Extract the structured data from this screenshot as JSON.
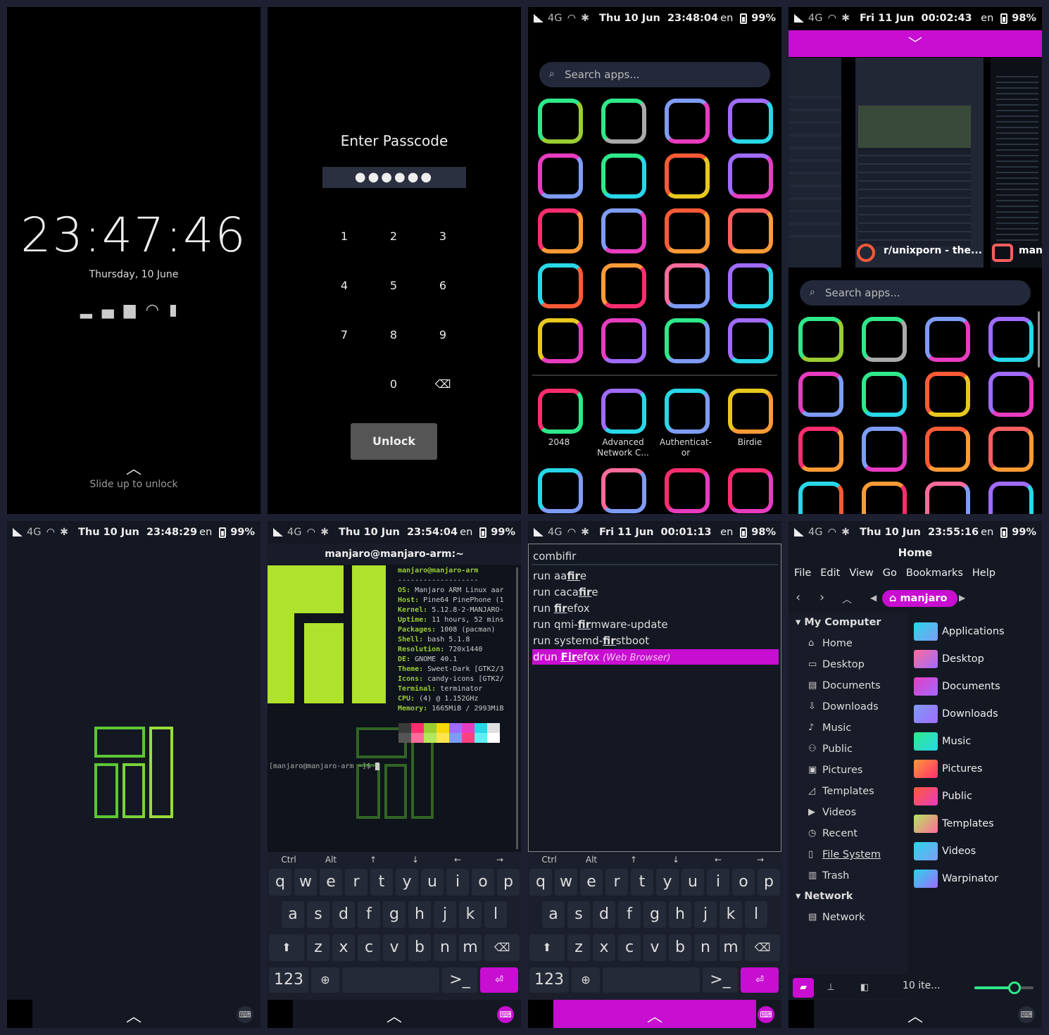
{
  "status": {
    "net": "4G",
    "lang": "en",
    "p3": {
      "date": "Thu 10 Jun",
      "time": "23:48:04",
      "battery": "99%"
    },
    "p4": {
      "date": "Fri 11 Jun",
      "time": "00:02:43",
      "battery": "98%"
    },
    "p5": {
      "date": "Thu 10 Jun",
      "time": "23:48:29",
      "battery": "99%"
    },
    "p6": {
      "date": "Thu 10 Jun",
      "time": "23:54:04",
      "battery": "99%"
    },
    "p7": {
      "date": "Fri 11 Jun",
      "time": "00:01:13",
      "battery": "98%"
    },
    "p8": {
      "date": "Thu 10 Jun",
      "time": "23:55:16",
      "battery": "99%"
    }
  },
  "lock": {
    "time": "23:47:46",
    "date": "Thursday, 10 June",
    "hint": "Slide up to unlock"
  },
  "passcode": {
    "title": "Enter Passcode",
    "dots": "●●●●●●",
    "keys": [
      "1",
      "2",
      "3",
      "4",
      "5",
      "6",
      "7",
      "8",
      "9",
      "0"
    ],
    "unlock": "Unlock"
  },
  "launcher": {
    "search_placeholder": "Search apps...",
    "apps": [
      {
        "label": "2048"
      },
      {
        "label": "Advanced Network C..."
      },
      {
        "label": "Authenticat-or"
      },
      {
        "label": "Birdie"
      }
    ]
  },
  "overview": {
    "win1_title": "r/unixporn - the...",
    "win2_title": "manj"
  },
  "terminal": {
    "title": "manjaro@manjaro-arm:~",
    "header": "manjaro@manjaro-arm",
    "rule": "-------------------",
    "info": [
      {
        "k": "OS:",
        "v": "Manjaro ARM Linux aar"
      },
      {
        "k": "Host:",
        "v": "Pine64 PinePhone (1"
      },
      {
        "k": "Kernel:",
        "v": "5.12.8-2-MANJARO-"
      },
      {
        "k": "Uptime:",
        "v": "11 hours, 52 mins"
      },
      {
        "k": "Packages:",
        "v": "1008 (pacman)"
      },
      {
        "k": "Shell:",
        "v": "bash 5.1.8"
      },
      {
        "k": "Resolution:",
        "v": "720x1440"
      },
      {
        "k": "DE:",
        "v": "GNOME 40.1"
      },
      {
        "k": "Theme:",
        "v": "Sweet-Dark [GTK2/3"
      },
      {
        "k": "Icons:",
        "v": "candy-icons [GTK2/"
      },
      {
        "k": "Terminal:",
        "v": "terminator"
      },
      {
        "k": "CPU:",
        "v": "(4) @ 1.152GHz"
      },
      {
        "k": "Memory:",
        "v": "1665MiB / 2993MiB"
      }
    ],
    "prompt": "[manjaro@manjaro-arm ~]$",
    "palette": [
      "#3a3a3a",
      "#555555",
      "#ff2d6f",
      "#ff6b9a",
      "#9acd32",
      "#b3e85c",
      "#f5d90a",
      "#ffe44d",
      "#a06bff",
      "#7f9cf5",
      "#e83cc0",
      "#ff4081",
      "#28d7e8",
      "#5ff0f5",
      "#e0e0e0",
      "#ffffff"
    ]
  },
  "keyboard": {
    "mods": [
      "Ctrl",
      "Alt",
      "↑",
      "↓",
      "←",
      "→"
    ],
    "row1": [
      "q",
      "w",
      "e",
      "r",
      "t",
      "y",
      "u",
      "i",
      "o",
      "p"
    ],
    "row2": [
      "a",
      "s",
      "d",
      "f",
      "g",
      "h",
      "j",
      "k",
      "l"
    ],
    "row3": [
      "z",
      "x",
      "c",
      "v",
      "b",
      "n",
      "m"
    ],
    "num": "123",
    "term": ">_"
  },
  "rofi": {
    "input": "combifir",
    "items": [
      {
        "pre": "run aa",
        "m": "fir",
        "post": "e",
        "desc": ""
      },
      {
        "pre": "run caca",
        "m": "fir",
        "post": "e",
        "desc": ""
      },
      {
        "pre": "run ",
        "m": "fir",
        "post": "efox",
        "desc": ""
      },
      {
        "pre": "run qmi-",
        "m": "fir",
        "post": "mware-update",
        "desc": ""
      },
      {
        "pre": "run systemd-",
        "m": "fir",
        "post": "stboot",
        "desc": ""
      },
      {
        "pre": "drun ",
        "m": "Fir",
        "post": "efox ",
        "desc": "(Web Browser)"
      }
    ]
  },
  "files": {
    "title": "Home",
    "menu": [
      "File",
      "Edit",
      "View",
      "Go",
      "Bookmarks",
      "Help"
    ],
    "crumb": "manjaro",
    "tree_head": "My Computer",
    "tree": [
      "Home",
      "Desktop",
      "Documents",
      "Downloads",
      "Music",
      "Public",
      "Pictures",
      "Templates",
      "Videos",
      "Recent",
      "File System",
      "Trash"
    ],
    "tree_head2": "Network",
    "tree2": [
      "Network"
    ],
    "folders": [
      "Applications",
      "Desktop",
      "Documents",
      "Downloads",
      "Music",
      "Pictures",
      "Public",
      "Templates",
      "Videos",
      "Warpinator"
    ],
    "count": "10 ite..."
  },
  "colors": {
    "accent": "#c80ed0",
    "green": "#9acd32"
  }
}
